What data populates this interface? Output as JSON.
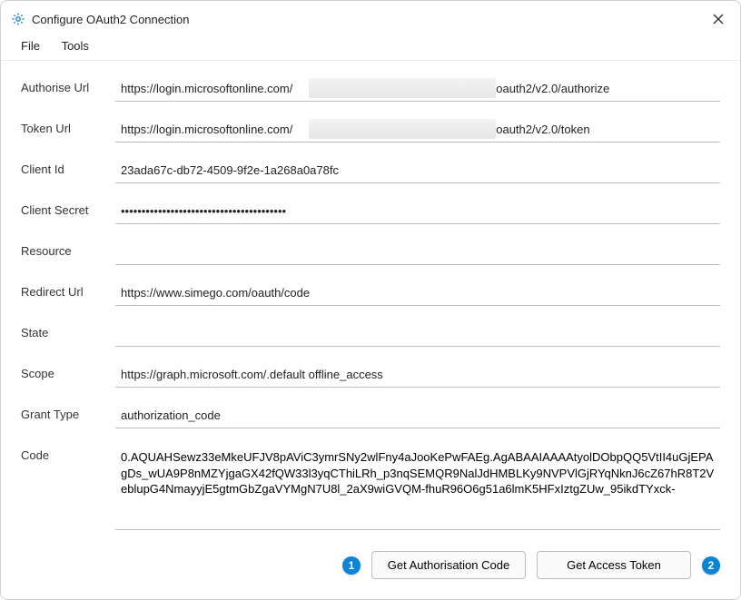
{
  "window": {
    "title": "Configure OAuth2 Connection"
  },
  "menu": {
    "file": "File",
    "tools": "Tools"
  },
  "labels": {
    "authorise_url": "Authorise Url",
    "token_url": "Token Url",
    "client_id": "Client Id",
    "client_secret": "Client Secret",
    "resource": "Resource",
    "redirect_url": "Redirect Url",
    "state": "State",
    "scope": "Scope",
    "grant_type": "Grant Type",
    "code": "Code"
  },
  "values": {
    "authorise_url": "https://login.microsoftonline.com/                                                             /oauth2/v2.0/authorize",
    "token_url": "https://login.microsoftonline.com/                                                             /oauth2/v2.0/token",
    "client_id": "23ada67c-db72-4509-9f2e-1a268a0a78fc",
    "client_secret": "••••••••••••••••••••••••••••••••••••••••",
    "resource": "",
    "redirect_url": "https://www.simego.com/oauth/code",
    "state": "",
    "scope": "https://graph.microsoft.com/.default offline_access",
    "grant_type": "authorization_code",
    "code": "0.AQUAHSewz33eMkeUFJV8pAViC3ymrSNy2wlFny4aJooKePwFAEg.AgABAAIAAAAtyolDObpQQ5VtII4uGjEPAgDs_wUA9P8nMZYjgaGX42fQW33l3yqCThiLRh_p3nqSEMQR9NalJdHMBLKy9NVPVlGjRYqNknJ6cZ67hR8T2VeblupG4NmayyjE5gtmGbZgaVYMgN7U8l_2aX9wiGVQM-fhuR96O6g51a6lmK5HFxIztgZUw_95ikdTYxck-"
  },
  "buttons": {
    "get_auth": "Get Authorisation Code",
    "get_token": "Get Access Token"
  },
  "badges": {
    "one": "1",
    "two": "2"
  }
}
